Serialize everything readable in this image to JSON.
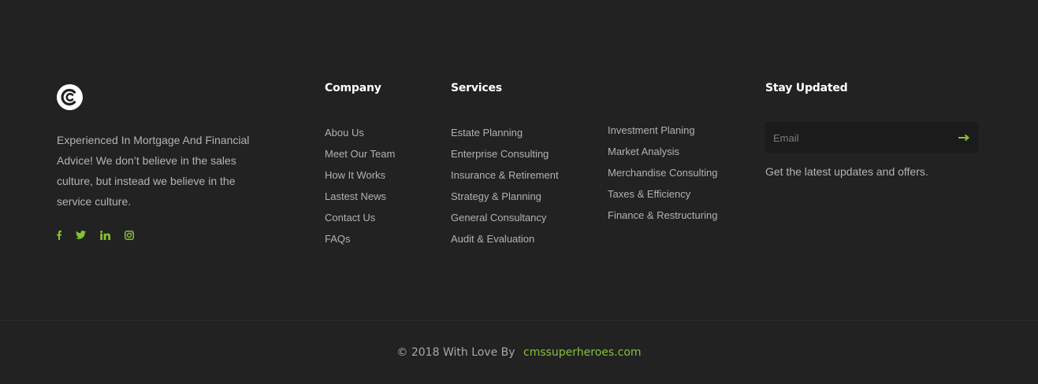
{
  "brand": {
    "logo_icon": "brand-c-logo",
    "about_text": "Experienced In Mortgage And Financial Advice! We don’t believe in the sales culture, but instead we believe in the service culture."
  },
  "socials": [
    {
      "icon": "facebook-icon"
    },
    {
      "icon": "twitter-icon"
    },
    {
      "icon": "linkedin-icon"
    },
    {
      "icon": "instagram-icon"
    }
  ],
  "company": {
    "title": "Company",
    "links": [
      "Abou Us",
      "Meet Our Team",
      "How It Works",
      "Lastest News",
      "Contact Us",
      "FAQs"
    ]
  },
  "services": {
    "title": "Services",
    "links_col1": [
      "Estate Planning",
      "Enterprise Consulting",
      "Insurance & Retirement",
      "Strategy & Planning",
      "General Consultancy",
      "Audit & Evaluation"
    ],
    "links_col2": [
      "Investment Planing",
      "Market Analysis",
      "Merchandise Consulting",
      "Taxes & Efficiency",
      "Finance & Restructuring"
    ]
  },
  "newsletter": {
    "title": "Stay Updated",
    "email_placeholder": "Email",
    "submit_icon": "arrow-right-icon",
    "text": "Get the latest updates and offers."
  },
  "copyright": {
    "text": "© 2018 With Love By",
    "link_text": "cmssuperheroes.com"
  },
  "colors": {
    "background": "#222222",
    "accent": "#86c232",
    "heading": "#ffffff",
    "text": "#b2b2b2"
  }
}
